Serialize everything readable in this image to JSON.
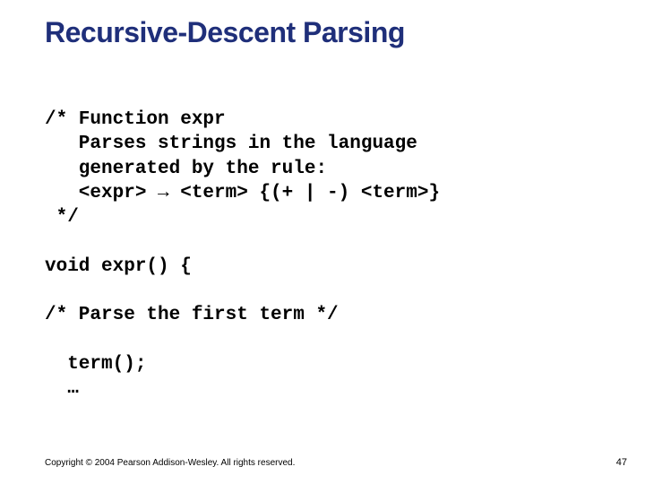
{
  "title": "Recursive-Descent Parsing",
  "code": "/* Function expr\n   Parses strings in the language\n   generated by the rule:\n   <expr> → <term> {(+ | -) <term>}\n */\n\nvoid expr() {\n\n/* Parse the first term */\n\n  term();\n  …",
  "footer": {
    "copyright": "Copyright © 2004 Pearson Addison-Wesley. All rights reserved.",
    "pagenum": "47"
  }
}
